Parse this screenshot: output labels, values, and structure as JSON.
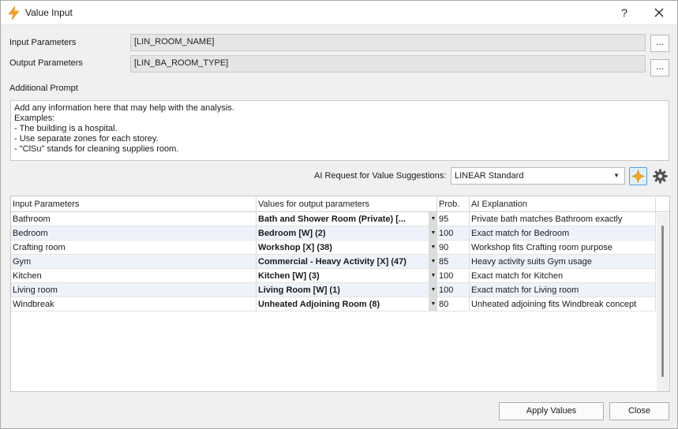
{
  "window": {
    "title": "Value Input",
    "help_label": "?"
  },
  "inputs": {
    "input_label": "Input Parameters",
    "input_value": "[LIN_ROOM_NAME]",
    "output_label": "Output Parameters",
    "output_value": "[LIN_BA_ROOM_TYPE]",
    "browse_label": "...",
    "prompt_label": "Additional Prompt",
    "prompt_text": "Add any information here that may help with the analysis.\nExamples:\n- The building is a hospital.\n- Use separate zones for each storey.\n- \"ClSu\" stands for cleaning supplies room."
  },
  "ai_request": {
    "label": "AI Request for Value Suggestions:",
    "selected": "LINEAR Standard"
  },
  "grid": {
    "headers": [
      "Input Parameters",
      "Values for output parameters",
      "Prob.",
      "AI Explanation"
    ],
    "rows": [
      {
        "input": "Bathroom",
        "value": "Bath and Shower Room  (Private) [...",
        "prob": "95",
        "explanation": "Private bath matches Bathroom exactly"
      },
      {
        "input": "Bedroom",
        "value": "Bedroom [W] (2)",
        "prob": "100",
        "explanation": "Exact match for Bedroom"
      },
      {
        "input": "Crafting room",
        "value": "Workshop [X] (38)",
        "prob": "90",
        "explanation": "Workshop fits Crafting room purpose"
      },
      {
        "input": "Gym",
        "value": "Commercial - Heavy Activity [X] (47)",
        "prob": "85",
        "explanation": "Heavy activity suits Gym usage"
      },
      {
        "input": "Kitchen",
        "value": "Kitchen [W] (3)",
        "prob": "100",
        "explanation": "Exact match for Kitchen"
      },
      {
        "input": "Living room",
        "value": "Living Room [W] (1)",
        "prob": "100",
        "explanation": "Exact match for Living room"
      },
      {
        "input": "Windbreak",
        "value": "Unheated Adjoining Room (8)",
        "prob": "80",
        "explanation": "Unheated adjoining fits Windbreak concept"
      }
    ]
  },
  "footer": {
    "apply_label": "Apply Values",
    "close_label": "Close"
  },
  "colors": {
    "accent": "#f5a623",
    "alt_row": "#eef3fb",
    "ai_button_border": "#4aa3df"
  }
}
